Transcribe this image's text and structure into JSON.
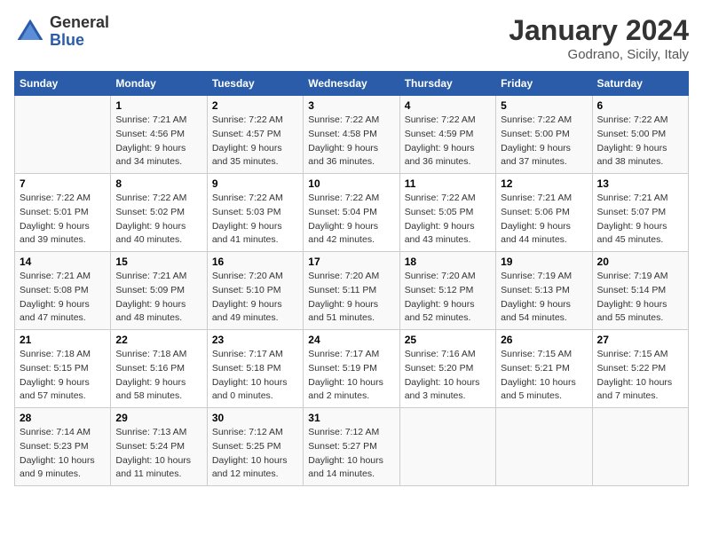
{
  "logo": {
    "general": "General",
    "blue": "Blue"
  },
  "title": "January 2024",
  "subtitle": "Godrano, Sicily, Italy",
  "weekdays": [
    "Sunday",
    "Monday",
    "Tuesday",
    "Wednesday",
    "Thursday",
    "Friday",
    "Saturday"
  ],
  "weeks": [
    [
      {
        "day": "",
        "sunrise": "",
        "sunset": "",
        "daylight": ""
      },
      {
        "day": "1",
        "sunrise": "Sunrise: 7:21 AM",
        "sunset": "Sunset: 4:56 PM",
        "daylight": "Daylight: 9 hours and 34 minutes."
      },
      {
        "day": "2",
        "sunrise": "Sunrise: 7:22 AM",
        "sunset": "Sunset: 4:57 PM",
        "daylight": "Daylight: 9 hours and 35 minutes."
      },
      {
        "day": "3",
        "sunrise": "Sunrise: 7:22 AM",
        "sunset": "Sunset: 4:58 PM",
        "daylight": "Daylight: 9 hours and 36 minutes."
      },
      {
        "day": "4",
        "sunrise": "Sunrise: 7:22 AM",
        "sunset": "Sunset: 4:59 PM",
        "daylight": "Daylight: 9 hours and 36 minutes."
      },
      {
        "day": "5",
        "sunrise": "Sunrise: 7:22 AM",
        "sunset": "Sunset: 5:00 PM",
        "daylight": "Daylight: 9 hours and 37 minutes."
      },
      {
        "day": "6",
        "sunrise": "Sunrise: 7:22 AM",
        "sunset": "Sunset: 5:00 PM",
        "daylight": "Daylight: 9 hours and 38 minutes."
      }
    ],
    [
      {
        "day": "7",
        "sunrise": "Sunrise: 7:22 AM",
        "sunset": "Sunset: 5:01 PM",
        "daylight": "Daylight: 9 hours and 39 minutes."
      },
      {
        "day": "8",
        "sunrise": "Sunrise: 7:22 AM",
        "sunset": "Sunset: 5:02 PM",
        "daylight": "Daylight: 9 hours and 40 minutes."
      },
      {
        "day": "9",
        "sunrise": "Sunrise: 7:22 AM",
        "sunset": "Sunset: 5:03 PM",
        "daylight": "Daylight: 9 hours and 41 minutes."
      },
      {
        "day": "10",
        "sunrise": "Sunrise: 7:22 AM",
        "sunset": "Sunset: 5:04 PM",
        "daylight": "Daylight: 9 hours and 42 minutes."
      },
      {
        "day": "11",
        "sunrise": "Sunrise: 7:22 AM",
        "sunset": "Sunset: 5:05 PM",
        "daylight": "Daylight: 9 hours and 43 minutes."
      },
      {
        "day": "12",
        "sunrise": "Sunrise: 7:21 AM",
        "sunset": "Sunset: 5:06 PM",
        "daylight": "Daylight: 9 hours and 44 minutes."
      },
      {
        "day": "13",
        "sunrise": "Sunrise: 7:21 AM",
        "sunset": "Sunset: 5:07 PM",
        "daylight": "Daylight: 9 hours and 45 minutes."
      }
    ],
    [
      {
        "day": "14",
        "sunrise": "Sunrise: 7:21 AM",
        "sunset": "Sunset: 5:08 PM",
        "daylight": "Daylight: 9 hours and 47 minutes."
      },
      {
        "day": "15",
        "sunrise": "Sunrise: 7:21 AM",
        "sunset": "Sunset: 5:09 PM",
        "daylight": "Daylight: 9 hours and 48 minutes."
      },
      {
        "day": "16",
        "sunrise": "Sunrise: 7:20 AM",
        "sunset": "Sunset: 5:10 PM",
        "daylight": "Daylight: 9 hours and 49 minutes."
      },
      {
        "day": "17",
        "sunrise": "Sunrise: 7:20 AM",
        "sunset": "Sunset: 5:11 PM",
        "daylight": "Daylight: 9 hours and 51 minutes."
      },
      {
        "day": "18",
        "sunrise": "Sunrise: 7:20 AM",
        "sunset": "Sunset: 5:12 PM",
        "daylight": "Daylight: 9 hours and 52 minutes."
      },
      {
        "day": "19",
        "sunrise": "Sunrise: 7:19 AM",
        "sunset": "Sunset: 5:13 PM",
        "daylight": "Daylight: 9 hours and 54 minutes."
      },
      {
        "day": "20",
        "sunrise": "Sunrise: 7:19 AM",
        "sunset": "Sunset: 5:14 PM",
        "daylight": "Daylight: 9 hours and 55 minutes."
      }
    ],
    [
      {
        "day": "21",
        "sunrise": "Sunrise: 7:18 AM",
        "sunset": "Sunset: 5:15 PM",
        "daylight": "Daylight: 9 hours and 57 minutes."
      },
      {
        "day": "22",
        "sunrise": "Sunrise: 7:18 AM",
        "sunset": "Sunset: 5:16 PM",
        "daylight": "Daylight: 9 hours and 58 minutes."
      },
      {
        "day": "23",
        "sunrise": "Sunrise: 7:17 AM",
        "sunset": "Sunset: 5:18 PM",
        "daylight": "Daylight: 10 hours and 0 minutes."
      },
      {
        "day": "24",
        "sunrise": "Sunrise: 7:17 AM",
        "sunset": "Sunset: 5:19 PM",
        "daylight": "Daylight: 10 hours and 2 minutes."
      },
      {
        "day": "25",
        "sunrise": "Sunrise: 7:16 AM",
        "sunset": "Sunset: 5:20 PM",
        "daylight": "Daylight: 10 hours and 3 minutes."
      },
      {
        "day": "26",
        "sunrise": "Sunrise: 7:15 AM",
        "sunset": "Sunset: 5:21 PM",
        "daylight": "Daylight: 10 hours and 5 minutes."
      },
      {
        "day": "27",
        "sunrise": "Sunrise: 7:15 AM",
        "sunset": "Sunset: 5:22 PM",
        "daylight": "Daylight: 10 hours and 7 minutes."
      }
    ],
    [
      {
        "day": "28",
        "sunrise": "Sunrise: 7:14 AM",
        "sunset": "Sunset: 5:23 PM",
        "daylight": "Daylight: 10 hours and 9 minutes."
      },
      {
        "day": "29",
        "sunrise": "Sunrise: 7:13 AM",
        "sunset": "Sunset: 5:24 PM",
        "daylight": "Daylight: 10 hours and 11 minutes."
      },
      {
        "day": "30",
        "sunrise": "Sunrise: 7:12 AM",
        "sunset": "Sunset: 5:25 PM",
        "daylight": "Daylight: 10 hours and 12 minutes."
      },
      {
        "day": "31",
        "sunrise": "Sunrise: 7:12 AM",
        "sunset": "Sunset: 5:27 PM",
        "daylight": "Daylight: 10 hours and 14 minutes."
      },
      {
        "day": "",
        "sunrise": "",
        "sunset": "",
        "daylight": ""
      },
      {
        "day": "",
        "sunrise": "",
        "sunset": "",
        "daylight": ""
      },
      {
        "day": "",
        "sunrise": "",
        "sunset": "",
        "daylight": ""
      }
    ]
  ]
}
